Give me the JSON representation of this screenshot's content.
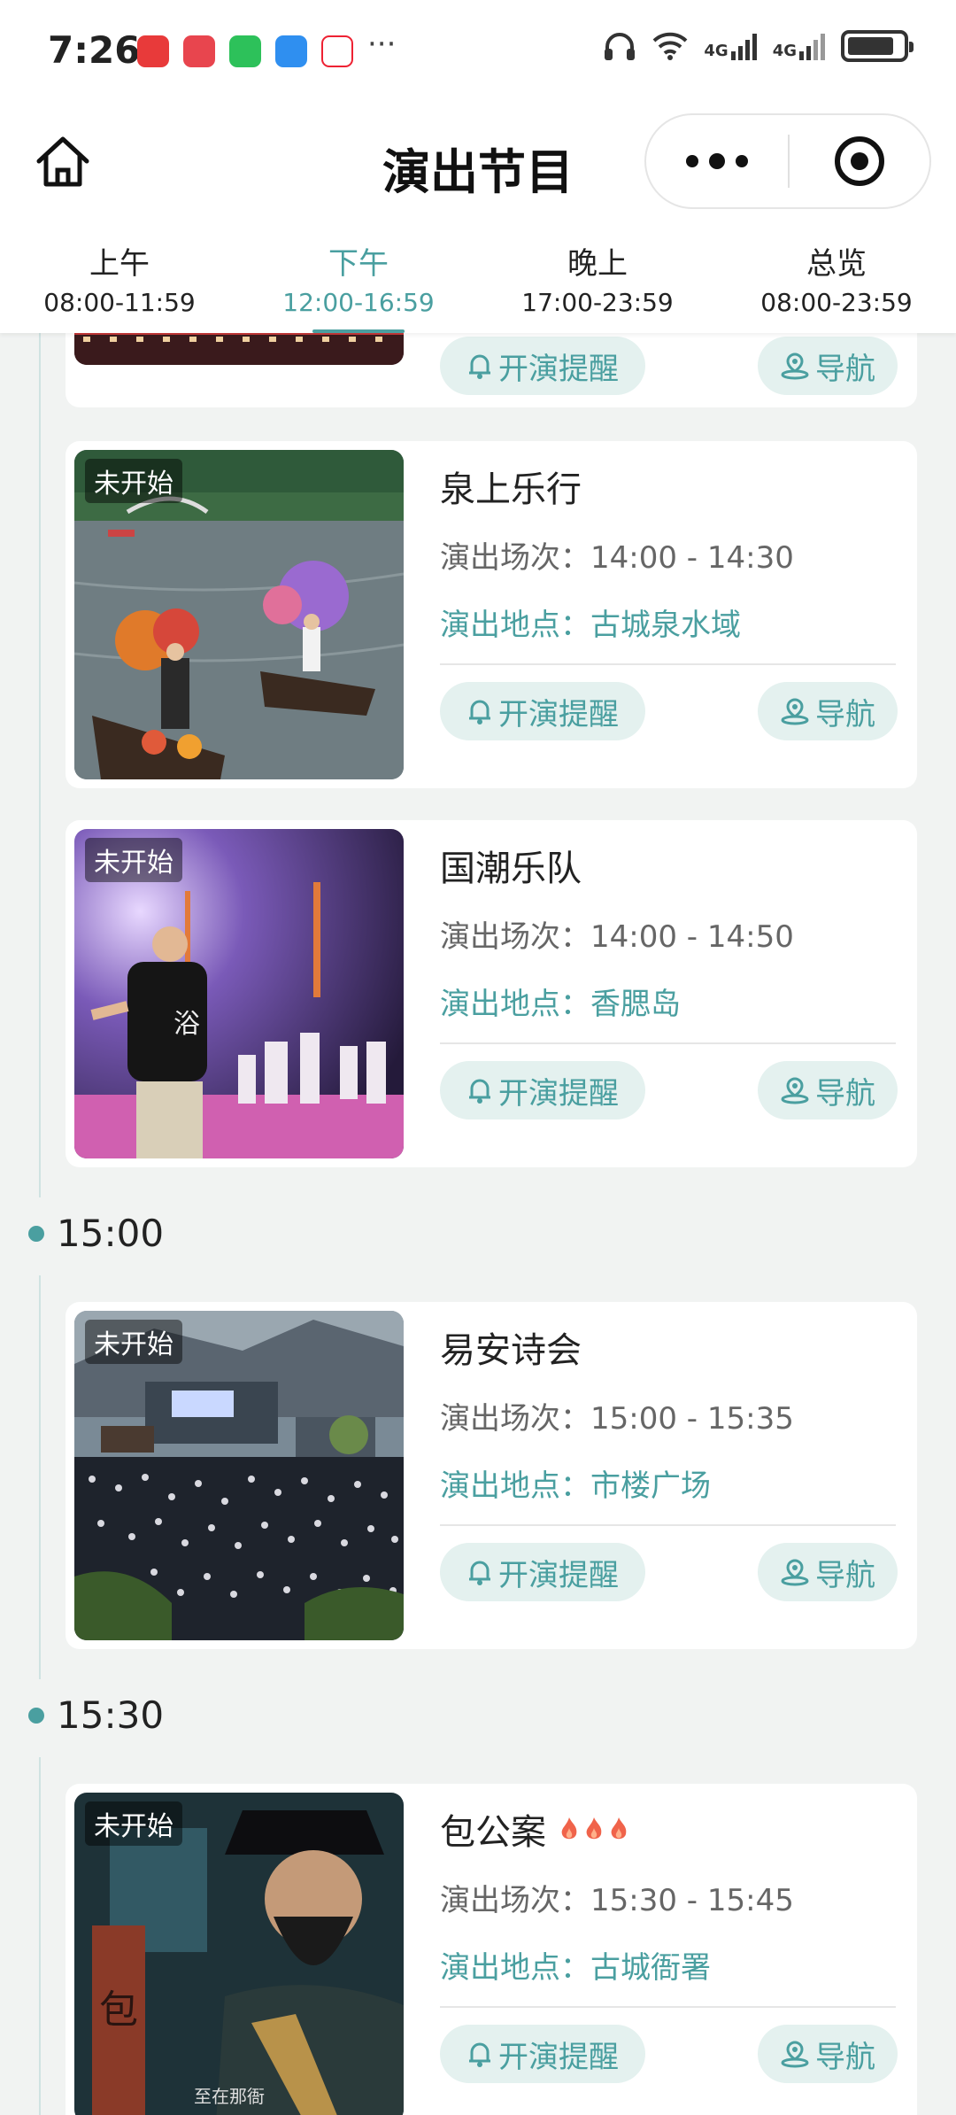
{
  "status_bar": {
    "time": "7:26",
    "app_icons": [
      "huawei-appgallery-icon",
      "red-app-icon",
      "wechat-icon",
      "cloud-icon",
      "heart-app-icon"
    ],
    "more": "···",
    "network_1": "4G",
    "network_2": "4G",
    "battery_level": 0.85
  },
  "nav": {
    "title": "演出节目"
  },
  "tabs": [
    {
      "name": "上午",
      "time": "08:00-11:59",
      "active": false
    },
    {
      "name": "下午",
      "time": "12:00-16:59",
      "active": true
    },
    {
      "name": "晚上",
      "time": "17:00-23:59",
      "active": false
    },
    {
      "name": "总览",
      "time": "08:00-23:59",
      "active": false
    }
  ],
  "labels": {
    "remind": "开演提醒",
    "navigate": "导航"
  },
  "sections": [
    {
      "time": "15:00"
    },
    {
      "time": "15:30"
    }
  ],
  "shows": [
    {
      "name": "",
      "status": "",
      "session": "",
      "place": ""
    },
    {
      "name": "泉上乐行",
      "status": "未开始",
      "session": "演出场次：14:00 - 14:30",
      "place": "演出地点：古城泉水域"
    },
    {
      "name": "国潮乐队",
      "status": "未开始",
      "session": "演出场次：14:00 - 14:50",
      "place": "演出地点：香腮岛"
    },
    {
      "name": "易安诗会",
      "status": "未开始",
      "session": "演出场次：15:00 - 15:35",
      "place": "演出地点：市楼广场"
    },
    {
      "name": "包公案",
      "status": "未开始",
      "session": "演出场次：15:30 - 15:45",
      "place": "演出地点：古城衙署",
      "hot_level": 3
    }
  ],
  "colors": {
    "accent": "#4a9fa0",
    "button_bg": "#e4f1ef",
    "page_bg": "#f1f3f2"
  }
}
